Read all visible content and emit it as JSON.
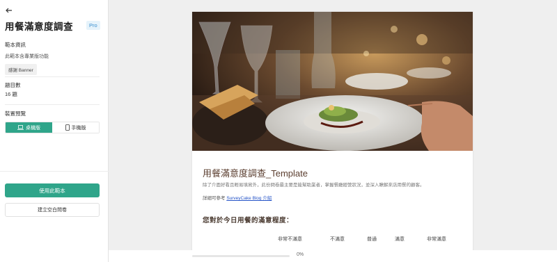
{
  "sidebar": {
    "title": "用餐滿意度調查",
    "pro_badge": "Pro",
    "info_heading": "範本資訊",
    "info_text": "此範本含專業版功能",
    "tag": "感謝 Banner",
    "question_count_label": "題目數",
    "question_count_value": "16 題",
    "preview_heading": "裝置預覽",
    "preview_desktop": "桌機版",
    "preview_mobile": "手機版",
    "use_template_button": "使用此範本",
    "create_blank_button": "建立空白問卷"
  },
  "survey": {
    "title": "用餐滿意度調查_Template",
    "description": "除了介面好看且輕易填寫外，此份問卷最主要是能幫助業者，掌握餐廳經營狀況，並深入瞭解來店用餐的顧客。",
    "ref_prefix": "詳細可參考 ",
    "ref_link": "SurveyCake Blog 介紹",
    "question": "您對於今日用餐的滿意程度：",
    "scale": [
      "非常不滿意",
      "不滿意",
      "普通",
      "滿意",
      "非常滿意"
    ]
  },
  "progress": {
    "value": 0,
    "label": "0%"
  },
  "colors": {
    "accent": "#2fa58a",
    "title_brown": "#5a3d2e",
    "link": "#2453c7"
  }
}
